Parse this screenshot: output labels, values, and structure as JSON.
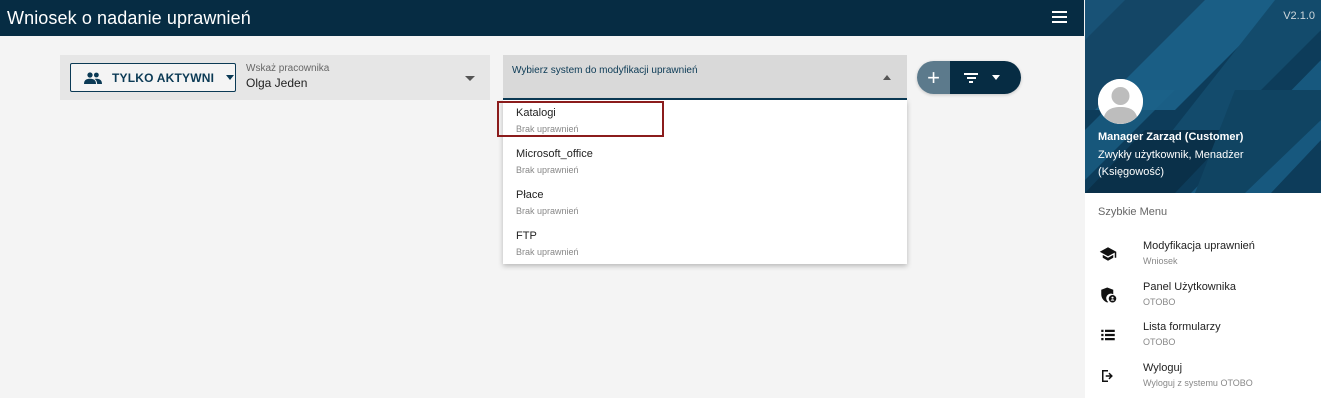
{
  "header": {
    "title": "Wniosek o nadanie uprawnień"
  },
  "employee_filter": {
    "toggle_label": "TYLKO AKTYWNI",
    "select_label": "Wskaż pracownika",
    "select_value": "Olga Jeden"
  },
  "system_select": {
    "label": "Wybierz system do modyfikacji uprawnień",
    "options": [
      {
        "name": "Katalogi",
        "status": "Brak uprawnień"
      },
      {
        "name": "Microsoft_office",
        "status": "Brak uprawnień"
      },
      {
        "name": "Płace",
        "status": "Brak uprawnień"
      },
      {
        "name": "FTP",
        "status": "Brak uprawnień"
      }
    ]
  },
  "actions": {
    "add_symbol": "+",
    "icons": [
      "plus-icon",
      "filter-icon",
      "caret-down-icon"
    ]
  },
  "sidebar": {
    "version": "V2.1.0",
    "user_name": "Manager Zarząd (Customer)",
    "user_role": "Zwykły użytkownik, Menadżer (Księgowość)",
    "quick_menu_title": "Szybkie Menu",
    "items": [
      {
        "title": "Modyfikacja uprawnień",
        "subtitle": "Wniosek",
        "icon": "graduation-cap-icon"
      },
      {
        "title": "Panel Użytkownika",
        "subtitle": "OTOBO",
        "icon": "user-shield-icon"
      },
      {
        "title": "Lista formularzy",
        "subtitle": "OTOBO",
        "icon": "list-icon"
      },
      {
        "title": "Wyloguj",
        "subtitle": "Wyloguj z systemu OTOBO",
        "icon": "logout-icon"
      }
    ]
  },
  "colors": {
    "primary": "#062c43",
    "highlight_border": "#8b1c1c",
    "add_button": "#5c7a8c"
  }
}
